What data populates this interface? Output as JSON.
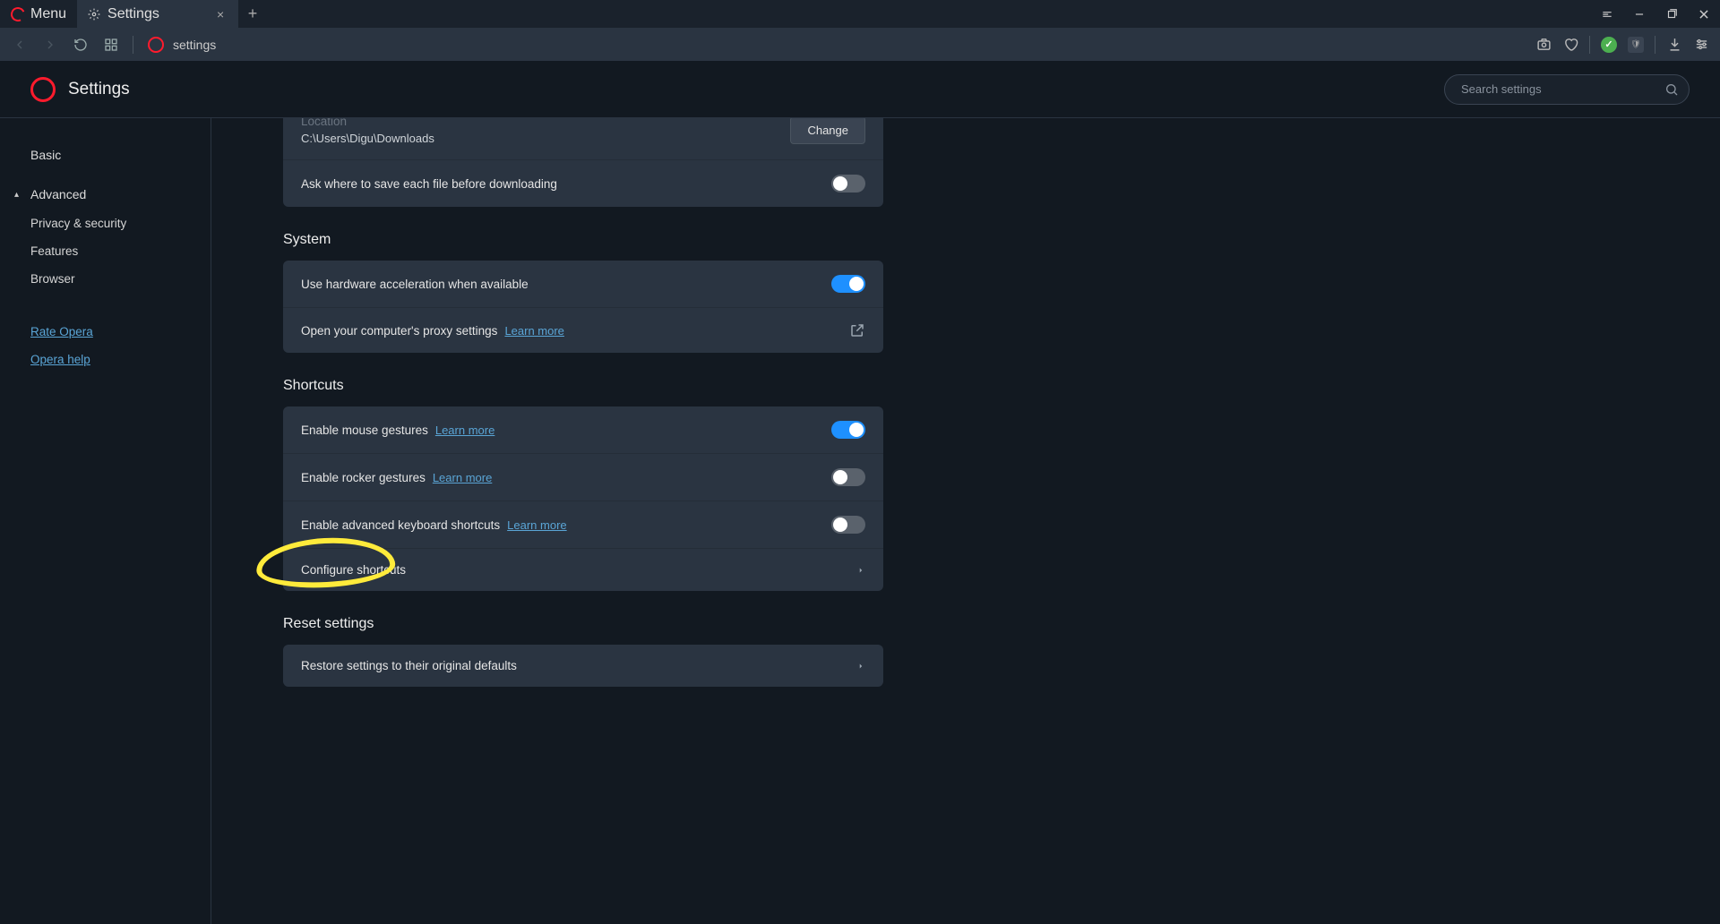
{
  "titlebar": {
    "menu": "Menu",
    "tab": "Settings"
  },
  "addr": {
    "url": "settings"
  },
  "header": {
    "title": "Settings",
    "search_placeholder": "Search settings"
  },
  "sidebar": {
    "basic": "Basic",
    "advanced": "Advanced",
    "privacy": "Privacy & security",
    "features": "Features",
    "browser": "Browser",
    "rate": "Rate Opera",
    "help": "Opera help"
  },
  "downloads": {
    "location_label": "Location",
    "location_path": "C:\\Users\\Digu\\Downloads",
    "change_btn": "Change",
    "ask_label": "Ask where to save each file before downloading"
  },
  "system": {
    "title": "System",
    "hw_accel": "Use hardware acceleration when available",
    "proxy": "Open your computer's proxy settings",
    "proxy_link": "Learn more"
  },
  "shortcuts": {
    "title": "Shortcuts",
    "mouse": "Enable mouse gestures",
    "mouse_link": "Learn more",
    "rocker": "Enable rocker gestures",
    "rocker_link": "Learn more",
    "advkb": "Enable advanced keyboard shortcuts",
    "advkb_link": "Learn more",
    "configure": "Configure shortcuts"
  },
  "reset": {
    "title": "Reset settings",
    "restore": "Restore settings to their original defaults"
  }
}
